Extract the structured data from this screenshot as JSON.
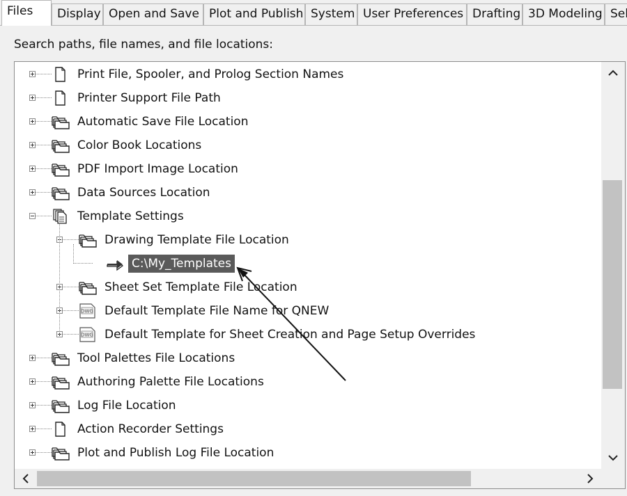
{
  "tabs": [
    {
      "label": "Files",
      "active": true
    },
    {
      "label": "Display",
      "active": false
    },
    {
      "label": "Open and Save",
      "active": false
    },
    {
      "label": "Plot and Publish",
      "active": false
    },
    {
      "label": "System",
      "active": false
    },
    {
      "label": "User Preferences",
      "active": false
    },
    {
      "label": "Drafting",
      "active": false
    },
    {
      "label": "3D Modeling",
      "active": false
    },
    {
      "label": "Sel",
      "active": false
    }
  ],
  "caption": "Search paths, file names, and file locations:",
  "tree": [
    {
      "label": "Print File, Spooler, and Prolog Section Names",
      "icon": "document-icon",
      "level": 0,
      "expander": "plus"
    },
    {
      "label": "Printer Support File Path",
      "icon": "document-icon",
      "level": 0,
      "expander": "plus"
    },
    {
      "label": "Automatic Save File Location",
      "icon": "folder-stack-icon",
      "level": 0,
      "expander": "plus"
    },
    {
      "label": "Color Book Locations",
      "icon": "folder-stack-icon",
      "level": 0,
      "expander": "plus"
    },
    {
      "label": "PDF Import Image Location",
      "icon": "folder-stack-icon",
      "level": 0,
      "expander": "plus"
    },
    {
      "label": "Data Sources Location",
      "icon": "folder-stack-icon",
      "level": 0,
      "expander": "plus"
    },
    {
      "label": "Template Settings",
      "icon": "document-stack-icon",
      "level": 0,
      "expander": "minus"
    },
    {
      "label": "Drawing Template File Location",
      "icon": "folder-stack-icon",
      "level": 1,
      "expander": "minus"
    },
    {
      "label": "C:\\My_Templates",
      "icon": "path-arrow-icon",
      "level": 2,
      "expander": "none",
      "selected": true
    },
    {
      "label": "Sheet Set Template File Location",
      "icon": "folder-stack-icon",
      "level": 1,
      "expander": "plus"
    },
    {
      "label": "Default Template File Name for QNEW",
      "icon": "dwg-file-icon",
      "level": 1,
      "expander": "plus"
    },
    {
      "label": "Default Template for Sheet Creation and Page Setup Overrides",
      "icon": "dwg-file-icon",
      "level": 1,
      "expander": "plus"
    },
    {
      "label": "Tool Palettes File Locations",
      "icon": "folder-stack-icon",
      "level": 0,
      "expander": "plus"
    },
    {
      "label": "Authoring Palette File Locations",
      "icon": "folder-stack-icon",
      "level": 0,
      "expander": "plus"
    },
    {
      "label": "Log File Location",
      "icon": "folder-stack-icon",
      "level": 0,
      "expander": "plus"
    },
    {
      "label": "Action Recorder Settings",
      "icon": "document-icon",
      "level": 0,
      "expander": "plus"
    },
    {
      "label": "Plot and Publish Log File Location",
      "icon": "folder-stack-icon",
      "level": 0,
      "expander": "plus"
    }
  ],
  "colors": {
    "selection_bg": "#5a5a5a",
    "selection_text": "#ffffff",
    "scroll_thumb": "#c2c2c2",
    "background": "#f0f0f0"
  }
}
